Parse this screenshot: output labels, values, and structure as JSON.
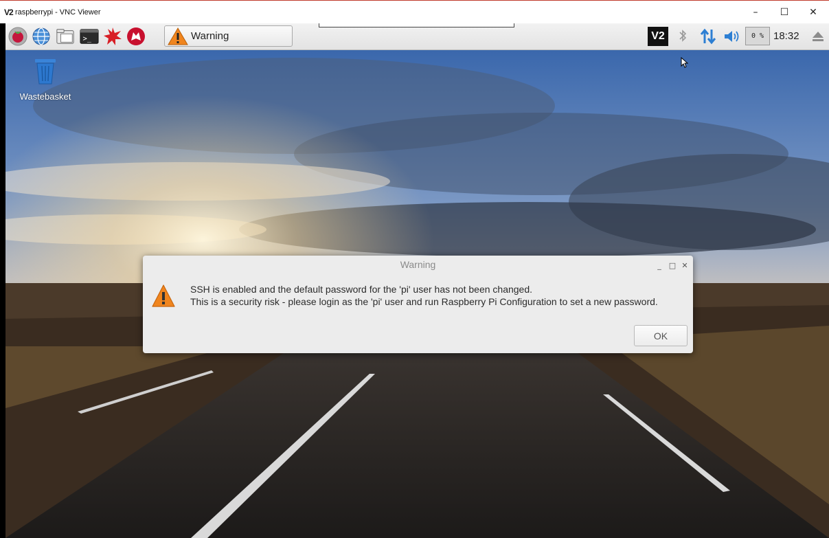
{
  "window": {
    "logo": "V2",
    "title": "raspberrypi - VNC Viewer",
    "minimize_icon": "–",
    "maximize_icon": "☐",
    "close_icon": "✕"
  },
  "panel": {
    "launchers": [
      {
        "name": "raspberry-menu-icon"
      },
      {
        "name": "web-browser-icon"
      },
      {
        "name": "file-manager-icon"
      },
      {
        "name": "terminal-icon"
      },
      {
        "name": "mathematica-icon"
      },
      {
        "name": "wolfram-icon"
      }
    ],
    "taskbar_item": {
      "label": "Warning",
      "icon": "warning-icon"
    },
    "tray": {
      "vnc_label": "V2",
      "cpu_usage": "0 %",
      "clock": "18:32"
    }
  },
  "desktop": {
    "icons": [
      {
        "label": "Wastebasket",
        "icon": "trash-icon"
      }
    ]
  },
  "dialog": {
    "title": "Warning",
    "minimize_icon": "_",
    "maximize_icon": "□",
    "close_icon": "✕",
    "message_line1": "SSH is enabled and the default password for the 'pi' user has not been changed.",
    "message_line2": "This is a security risk - please login as the 'pi' user and run Raspberry Pi Configuration to set a new password.",
    "ok_label": "OK"
  },
  "colors": {
    "warning_orange": "#f0851e",
    "panel_bg": "#ebebeb",
    "dialog_bg": "#ececec",
    "title_bar_accent": "#c0392b"
  }
}
